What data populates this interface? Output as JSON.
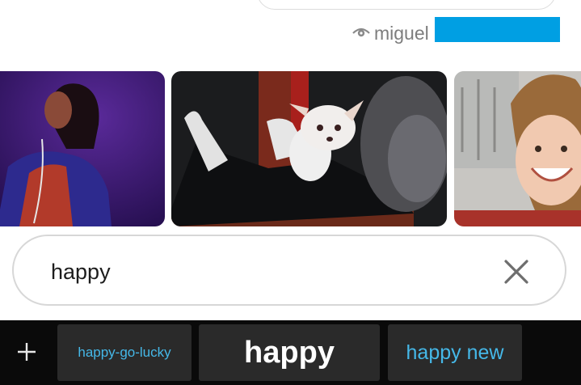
{
  "seen": {
    "name": "miguel",
    "icon": "eye-icon"
  },
  "gifs": [
    {
      "icon": "gif-person-laughing"
    },
    {
      "icon": "gif-chihuahua-in-cape"
    },
    {
      "icon": "gif-girl-smiling"
    }
  ],
  "search": {
    "value": "happy",
    "placeholder": ""
  },
  "suggestions": {
    "left": "happy-go-lucky",
    "center": "happy",
    "right": "happy new"
  },
  "colors": {
    "redaction": "#009fe3",
    "suggestion_accent": "#45b8e8",
    "keyboard_bg": "#0a0a0a",
    "chip_bg": "#2a2a2a"
  }
}
